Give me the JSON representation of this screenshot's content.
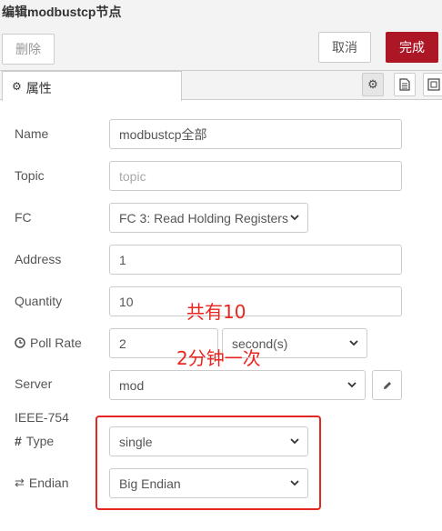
{
  "window": {
    "title": "编辑modbustcp节点"
  },
  "toolbar": {
    "delete_label": "删除",
    "cancel_label": "取消",
    "done_label": "完成"
  },
  "tabs": {
    "properties_label": "属性"
  },
  "form": {
    "name": {
      "label": "Name",
      "value": "modbustcp全部"
    },
    "topic": {
      "label": "Topic",
      "placeholder": "topic"
    },
    "fc": {
      "label": "FC",
      "selected": "FC 3: Read Holding Registers"
    },
    "address": {
      "label": "Address",
      "value": "1"
    },
    "quantity": {
      "label": "Quantity",
      "value": "10"
    },
    "poll_rate": {
      "label": "Poll Rate",
      "value": "2",
      "unit": "second(s)"
    },
    "server": {
      "label": "Server",
      "selected": "mod"
    },
    "ieee": {
      "label": "IEEE-754"
    },
    "type": {
      "label": "Type",
      "selected": "single"
    },
    "endian": {
      "label": "Endian",
      "selected": "Big Endian"
    }
  },
  "annotations": {
    "quantity_note": "共有10",
    "poll_note": "2分钟一次"
  },
  "colors": {
    "primary": "#ad1625",
    "annotation": "#e42622"
  }
}
